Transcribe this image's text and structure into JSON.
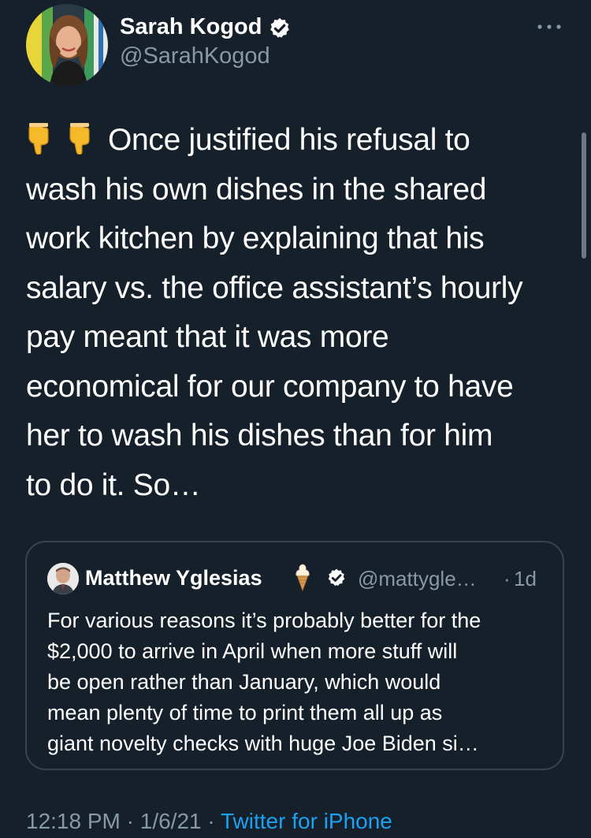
{
  "author": {
    "name": "Sarah Kogod",
    "handle": "@SarahKogod",
    "verified": true,
    "avatar_icon": "profile-photo-icon"
  },
  "menu": {
    "icon": "more-options-icon"
  },
  "tweet": {
    "leading_emoji": [
      "backhand-index-pointing-down",
      "backhand-index-pointing-down"
    ],
    "lines": [
      "Once justified his refusal to",
      "wash his own dishes in the shared",
      "work kitchen by explaining that his",
      "salary vs. the office assistant’s hourly",
      "pay meant that it was more",
      "economical for our company to have",
      "her to wash his dishes than for him",
      "to do it. So…"
    ]
  },
  "quote": {
    "name": "Matthew Yglesias",
    "name_emoji": "soft-ice-cream",
    "verified": true,
    "handle": "@mattygle…",
    "separator": "·",
    "time": "1d",
    "lines": [
      "For various reasons it’s probably better for the",
      "$2,000 to arrive in April when more stuff will",
      "be open rather than January, which would",
      "mean plenty of time to print them all up as",
      "giant novelty checks with huge Joe Biden si…"
    ]
  },
  "meta": {
    "time": "12:18 PM",
    "date": "1/6/21",
    "separator": "·",
    "source": "Twitter for iPhone"
  },
  "colors": {
    "background": "#15202b",
    "text": "#ffffff",
    "secondary": "#8899a6",
    "link": "#1da1f2",
    "border": "#38444d",
    "verified_badge": "#ffffff"
  }
}
